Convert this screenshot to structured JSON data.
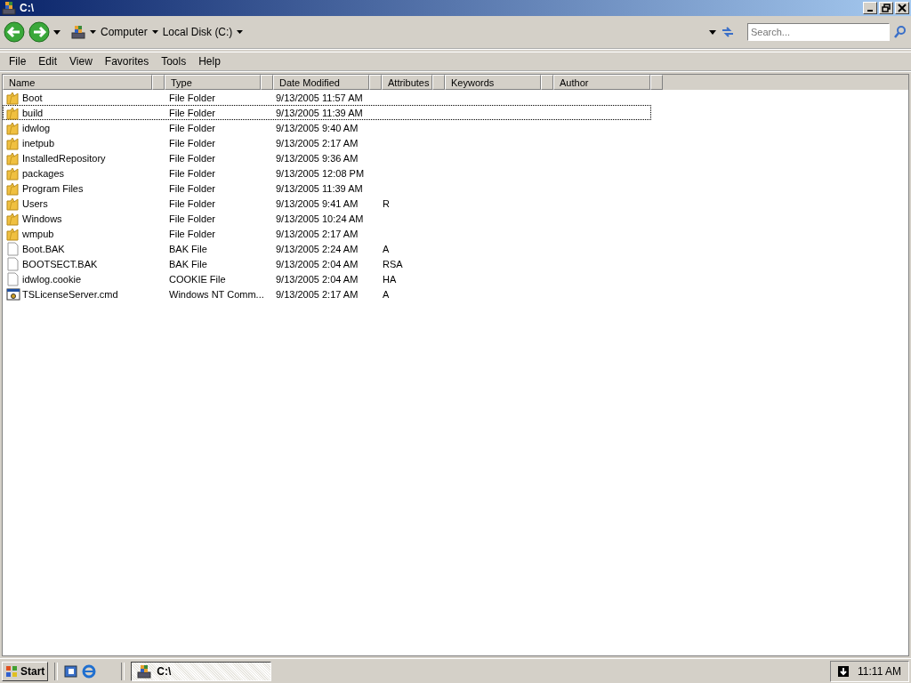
{
  "window": {
    "title": "C:\\"
  },
  "toolbar": {
    "breadcrumbs": [
      "Computer",
      "Local Disk (C:)"
    ],
    "search": {
      "placeholder": "Search..."
    }
  },
  "menu": [
    "File",
    "Edit",
    "View",
    "Favorites",
    "Tools",
    "Help"
  ],
  "table": {
    "columns": [
      "Name",
      "Type",
      "Date Modified",
      "Attributes",
      "Keywords",
      "Author"
    ],
    "rows": [
      {
        "kind": "folder",
        "focused": false,
        "cells": [
          "Boot",
          "File Folder",
          "9/13/2005 11:57 AM",
          ""
        ]
      },
      {
        "kind": "folder",
        "focused": true,
        "cells": [
          "build",
          "File Folder",
          "9/13/2005 11:39 AM",
          ""
        ]
      },
      {
        "kind": "folder",
        "focused": false,
        "cells": [
          "idwlog",
          "File Folder",
          "9/13/2005 9:40 AM",
          ""
        ]
      },
      {
        "kind": "folder",
        "focused": false,
        "cells": [
          "inetpub",
          "File Folder",
          "9/13/2005 2:17 AM",
          ""
        ]
      },
      {
        "kind": "folder",
        "focused": false,
        "cells": [
          "InstalledRepository",
          "File Folder",
          "9/13/2005 9:36 AM",
          ""
        ]
      },
      {
        "kind": "folder",
        "focused": false,
        "cells": [
          "packages",
          "File Folder",
          "9/13/2005 12:08 PM",
          ""
        ]
      },
      {
        "kind": "folder",
        "focused": false,
        "cells": [
          "Program Files",
          "File Folder",
          "9/13/2005 11:39 AM",
          ""
        ]
      },
      {
        "kind": "folder",
        "focused": false,
        "cells": [
          "Users",
          "File Folder",
          "9/13/2005 9:41 AM",
          "R"
        ]
      },
      {
        "kind": "folder",
        "focused": false,
        "cells": [
          "Windows",
          "File Folder",
          "9/13/2005 10:24 AM",
          ""
        ]
      },
      {
        "kind": "folder",
        "focused": false,
        "cells": [
          "wmpub",
          "File Folder",
          "9/13/2005 2:17 AM",
          ""
        ]
      },
      {
        "kind": "file",
        "focused": false,
        "cells": [
          "Boot.BAK",
          "BAK File",
          "9/13/2005 2:24 AM",
          "A"
        ]
      },
      {
        "kind": "file",
        "focused": false,
        "cells": [
          "BOOTSECT.BAK",
          "BAK File",
          "9/13/2005 2:04 AM",
          "RSA"
        ]
      },
      {
        "kind": "file",
        "focused": false,
        "cells": [
          "idwlog.cookie",
          "COOKIE File",
          "9/13/2005 2:04 AM",
          "HA"
        ]
      },
      {
        "kind": "command",
        "focused": false,
        "cells": [
          "TSLicenseServer.cmd",
          "Windows NT Comm...",
          "9/13/2005 2:17 AM",
          "A"
        ]
      }
    ]
  },
  "taskbar": {
    "start": "Start",
    "tasks": [
      {
        "label": "C:\\",
        "selected": true
      }
    ],
    "clock": "11:11 AM"
  }
}
